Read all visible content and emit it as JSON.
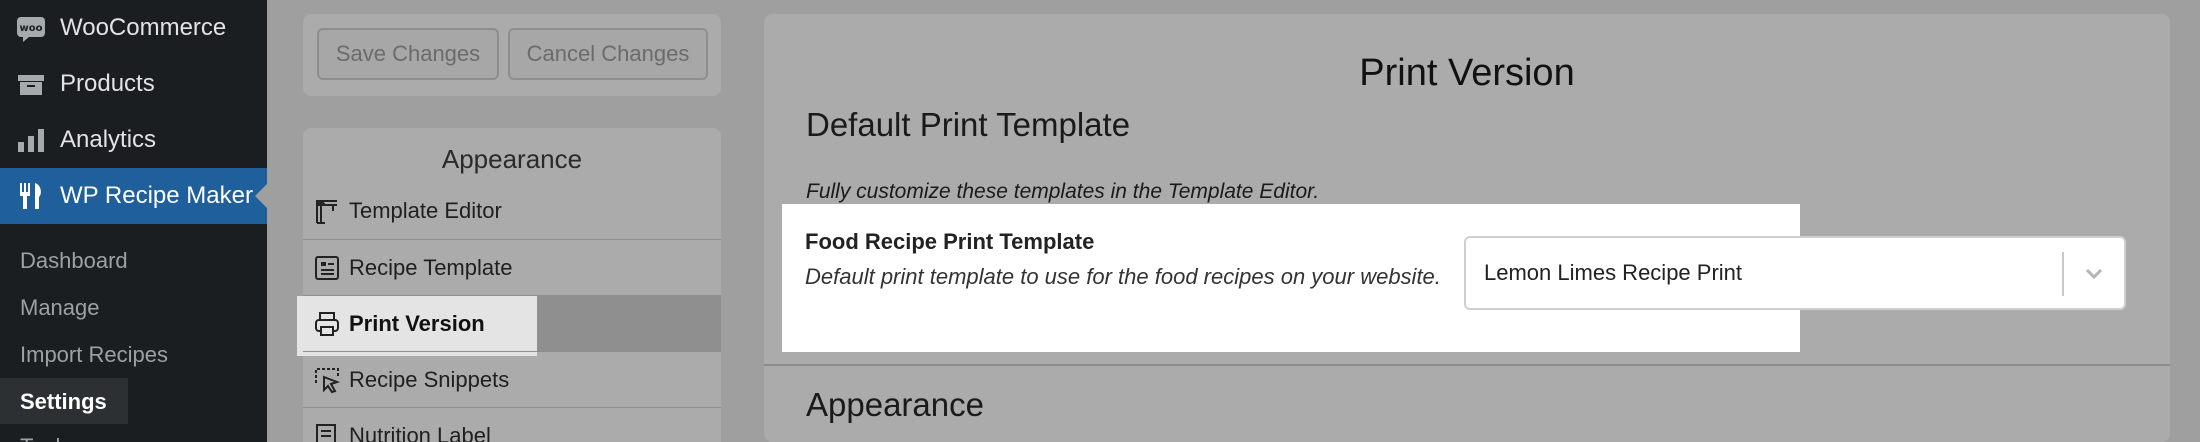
{
  "admin_menu": {
    "items": [
      {
        "label": "WooCommerce",
        "icon": "woocommerce-icon"
      },
      {
        "label": "Products",
        "icon": "archive-box-icon"
      },
      {
        "label": "Analytics",
        "icon": "bar-chart-icon"
      },
      {
        "label": "WP Recipe Maker",
        "icon": "fork-knife-icon",
        "active": true
      }
    ],
    "submenu": [
      {
        "label": "Dashboard"
      },
      {
        "label": "Manage"
      },
      {
        "label": "Import Recipes"
      },
      {
        "label": "Settings",
        "current": true
      },
      {
        "label": "Tools"
      }
    ]
  },
  "toolbar": {
    "save_label": "Save Changes",
    "cancel_label": "Cancel Changes"
  },
  "settings_nav": {
    "heading": "Appearance",
    "items": [
      {
        "label": "Template Editor",
        "icon": "crane-icon"
      },
      {
        "label": "Recipe Template",
        "icon": "template-list-icon"
      },
      {
        "label": "Print Version",
        "icon": "printer-icon",
        "selected": true
      },
      {
        "label": "Recipe Snippets",
        "icon": "cursor-select-icon"
      },
      {
        "label": "Nutrition Label",
        "icon": "nutrition-label-icon"
      }
    ]
  },
  "main": {
    "title": "Print Version",
    "section_default": "Default Print Template",
    "section_default_desc": "Fully customize these templates in the Template Editor.",
    "field": {
      "label": "Food Recipe Print Template",
      "help": "Default print template to use for the food recipes on your website.",
      "selected_value": "Lemon Limes Recipe Print"
    },
    "section_appearance": "Appearance"
  },
  "colors": {
    "sidebar_bg": "#1b1e20",
    "active_menu_bg": "#1f5f9c",
    "overlay_bg": "#9f9f9f",
    "spotlight_bg": "#ffffff"
  }
}
